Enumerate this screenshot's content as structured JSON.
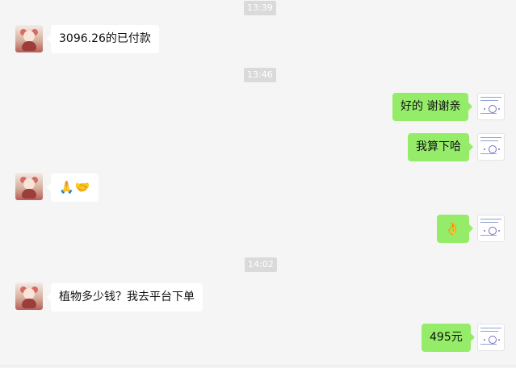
{
  "chat": {
    "timestamps": [
      "13:39",
      "13:46",
      "14:02"
    ],
    "messages": [
      {
        "side": "left",
        "text": "3096.26的已付款"
      },
      {
        "side": "right",
        "text": "好的 谢谢亲"
      },
      {
        "side": "right",
        "text": "我算下哈"
      },
      {
        "side": "left",
        "text": "🙏🤝"
      },
      {
        "side": "right",
        "text": "👌"
      },
      {
        "side": "left",
        "text": "植物多少钱？我去平台下单"
      },
      {
        "side": "right",
        "text": "495元"
      }
    ]
  },
  "icons": {
    "contact_avatar": "cartoon-figure-avatar-icon",
    "self_avatar": "document-thumbnail-avatar-icon"
  },
  "colors": {
    "background": "#f5f5f5",
    "incoming_bubble": "#ffffff",
    "outgoing_bubble": "#95ec69",
    "time_badge": "#dadada"
  }
}
